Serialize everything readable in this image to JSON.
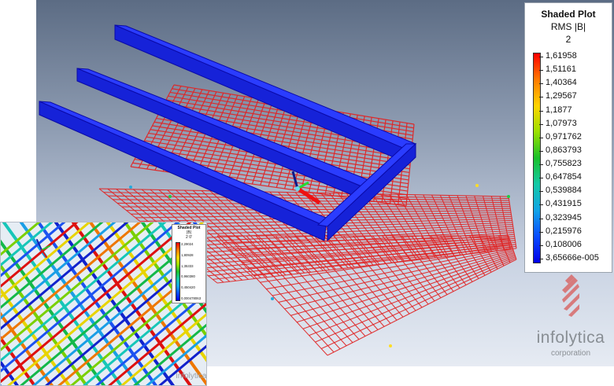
{
  "legend": {
    "title": "Shaded Plot",
    "quantity": "RMS |B|",
    "step": "2",
    "ticks": [
      "1,61958",
      "1,51161",
      "1,40364",
      "1,29567",
      "1,1877",
      "1,07973",
      "0,971762",
      "0,863793",
      "0,755823",
      "0,647854",
      "0,539884",
      "0,431915",
      "0,323945",
      "0,215976",
      "0,108006",
      "3,65666e-005"
    ],
    "gradient": [
      "#ff0000",
      "#ff7a00",
      "#ffd400",
      "#9be000",
      "#19c02a",
      "#14c9a6",
      "#12a4e6",
      "#0a4cff",
      "#0000e8"
    ]
  },
  "brand": {
    "name": "infolytica",
    "sub": "corporation"
  },
  "inset": {
    "legend": {
      "title": "Shaded Plot",
      "quantity": "|B|",
      "step": "2 0'",
      "ticks": [
        "2,29024",
        "1,80928",
        "1,35333",
        "0,960380",
        "0,450420",
        "0,000478063"
      ]
    },
    "brand": "Infolytica"
  },
  "colors": {
    "coil": "#1a2cf2",
    "coil_edge": "#0a0aa8",
    "mesh": "#e02525",
    "viewport_top": "#5c6c84"
  }
}
